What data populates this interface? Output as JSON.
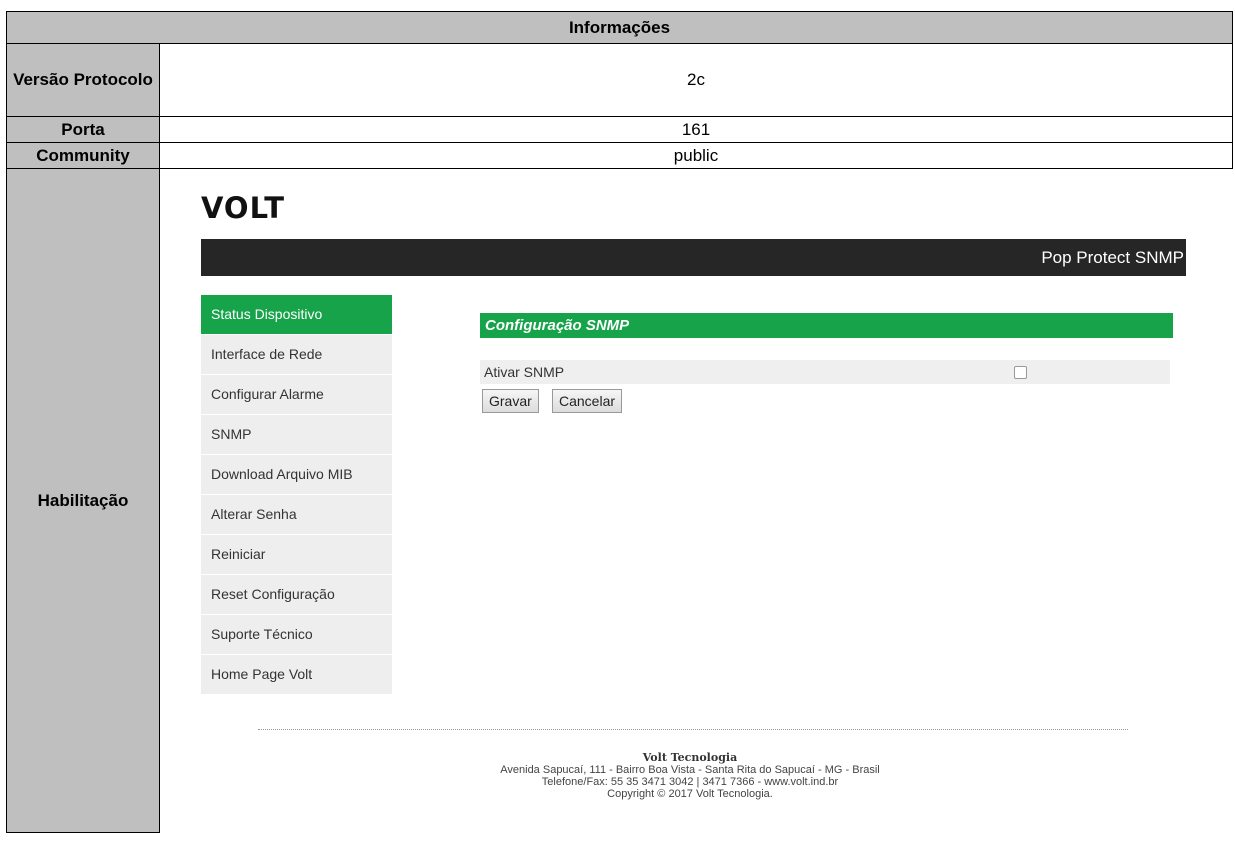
{
  "table": {
    "header": "Informações",
    "rows": [
      {
        "label": "Versão Protocolo",
        "value": "2c"
      },
      {
        "label": "Porta",
        "value": "161"
      },
      {
        "label": "Community",
        "value": "public"
      },
      {
        "label": "Habilitação"
      }
    ]
  },
  "app": {
    "logo": "VOLT",
    "title": "Pop Protect SNMP",
    "menu": [
      "Status Dispositivo",
      "Interface de Rede",
      "Configurar Alarme",
      "SNMP",
      "Download Arquivo MIB",
      "Alterar Senha",
      "Reiniciar",
      "Reset Configuração",
      "Suporte Técnico",
      "Home Page Volt"
    ],
    "section_title": "Configuração SNMP",
    "enable_label": "Ativar SNMP",
    "save_label": "Gravar",
    "cancel_label": "Cancelar",
    "accent_color": "#16a34a"
  },
  "footer": {
    "company": "Volt Tecnologia",
    "address": "Avenida Sapucaí, 111 - Bairro Boa Vista - Santa Rita do Sapucaí - MG - Brasil",
    "phone": "Telefone/Fax: 55 35 3471 3042 | 3471 7366 - www.volt.ind.br",
    "copyright": "Copyright © 2017 Volt Tecnologia."
  }
}
